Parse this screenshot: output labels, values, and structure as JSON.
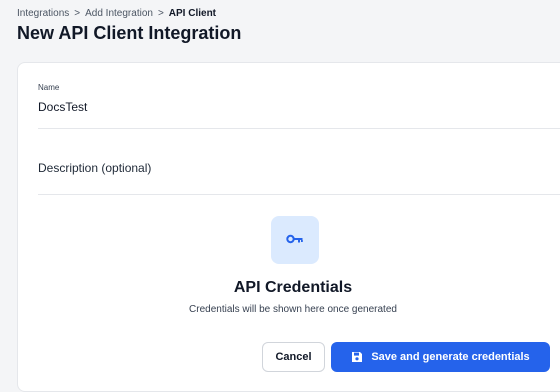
{
  "breadcrumb": {
    "items": [
      "Integrations",
      "Add Integration",
      "API Client"
    ],
    "separator": ">"
  },
  "page": {
    "title": "New API Client Integration"
  },
  "form": {
    "name": {
      "label": "Name",
      "value": "DocsTest"
    },
    "description": {
      "placeholder": "Description (optional)",
      "value": ""
    }
  },
  "credentials": {
    "icon": "key-icon",
    "title": "API Credentials",
    "subtitle": "Credentials will be shown here once generated"
  },
  "actions": {
    "cancel_label": "Cancel",
    "save_label": "Save and generate credentials",
    "save_icon": "floppy-disk-icon"
  },
  "colors": {
    "accent": "#2563eb",
    "icon_tile_bg": "#dbeafe",
    "background": "#f4f5f7"
  }
}
